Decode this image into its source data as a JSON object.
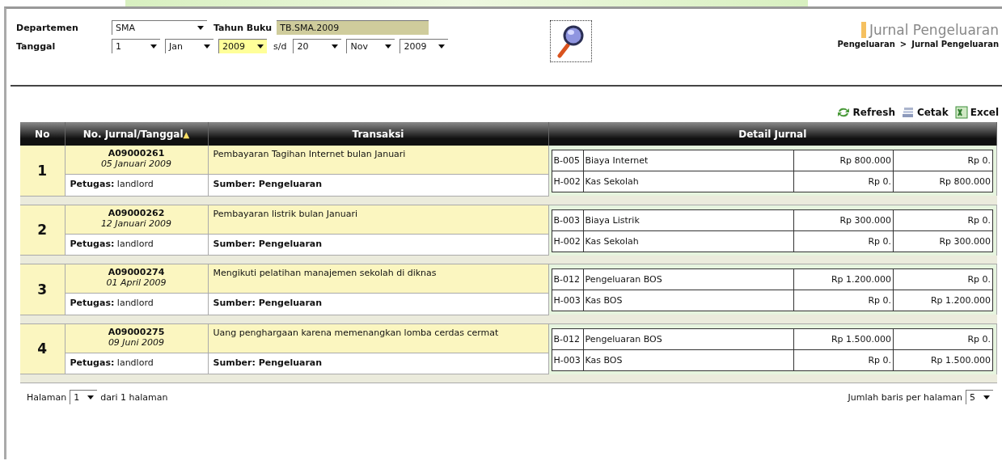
{
  "filters": {
    "departemen": {
      "label": "Departemen",
      "value": "SMA",
      "highlighted": false
    },
    "tahun_buku": {
      "label": "Tahun Buku",
      "value": "TB.SMA.2009"
    },
    "tanggal": {
      "label": "Tanggal",
      "separator": "s/d",
      "from": [
        {
          "value": "1",
          "highlighted": false
        },
        {
          "value": "Jan",
          "highlighted": false
        },
        {
          "value": "2009",
          "highlighted": true
        }
      ],
      "to": [
        {
          "value": "20",
          "highlighted": false
        },
        {
          "value": "Nov",
          "highlighted": false
        },
        {
          "value": "2009",
          "highlighted": false
        }
      ]
    }
  },
  "page_title": "Jurnal Pengeluaran",
  "breadcrumb": [
    "Pengeluaran",
    ">",
    "Jurnal Pengeluaran"
  ],
  "toolbar": [
    {
      "kind": "refresh",
      "label": "Refresh"
    },
    {
      "kind": "print",
      "label": "Cetak"
    },
    {
      "kind": "excel",
      "label": "Excel"
    }
  ],
  "table": {
    "columns": [
      {
        "label": "No"
      },
      {
        "label": "No. Jurnal/Tanggal",
        "sort_indicator": "▲"
      },
      {
        "label": "Transaksi"
      },
      {
        "label": "Detail Jurnal"
      }
    ],
    "rows": [
      {
        "no": "1",
        "journal": "A09000261",
        "date": "05 Januari 2009",
        "officer": "**Petugas:** landlord",
        "transaction": "Pembayaran Tagihan Internet bulan Januari",
        "source": "Sumber: Pengeluaran",
        "details": [
          [
            "B-005",
            "Biaya Internet",
            "Rp 800.000",
            "Rp 0."
          ],
          [
            "H-002",
            "Kas Sekolah",
            "Rp 0.",
            "Rp 800.000"
          ]
        ]
      },
      {
        "no": "2",
        "journal": "A09000262",
        "date": "12 Januari 2009",
        "officer": "**Petugas:** landlord",
        "transaction": "Pembayaran listrik bulan Januari",
        "source": "Sumber: Pengeluaran",
        "details": [
          [
            "B-003",
            "Biaya Listrik",
            "Rp 300.000",
            "Rp 0."
          ],
          [
            "H-002",
            "Kas Sekolah",
            "Rp 0.",
            "Rp 300.000"
          ]
        ]
      },
      {
        "no": "3",
        "journal": "A09000274",
        "date": "01 April 2009",
        "officer": "**Petugas:** landlord",
        "transaction": "Mengikuti pelatihan manajemen sekolah di diknas",
        "source": "Sumber: Pengeluaran",
        "details": [
          [
            "B-012",
            "Pengeluaran BOS",
            "Rp 1.200.000",
            "Rp 0."
          ],
          [
            "H-003",
            "Kas BOS",
            "Rp 0.",
            "Rp 1.200.000"
          ]
        ]
      },
      {
        "no": "4",
        "journal": "A09000275",
        "date": "09 Juni 2009",
        "officer": "**Petugas:** landlord",
        "transaction": "Uang penghargaan karena memenangkan lomba cerdas cermat",
        "source": "Sumber: Pengeluaran",
        "details": [
          [
            "B-012",
            "Pengeluaran BOS",
            "Rp 1.500.000",
            "Rp 0."
          ],
          [
            "H-003",
            "Kas BOS",
            "Rp 0.",
            "Rp 1.500.000"
          ]
        ]
      }
    ]
  },
  "pagination": {
    "page_label": "Halaman",
    "page": "1",
    "page_suffix": "dari 1 halaman",
    "rows_label": "Jumlah baris per halaman",
    "rows_per_page": "5"
  }
}
